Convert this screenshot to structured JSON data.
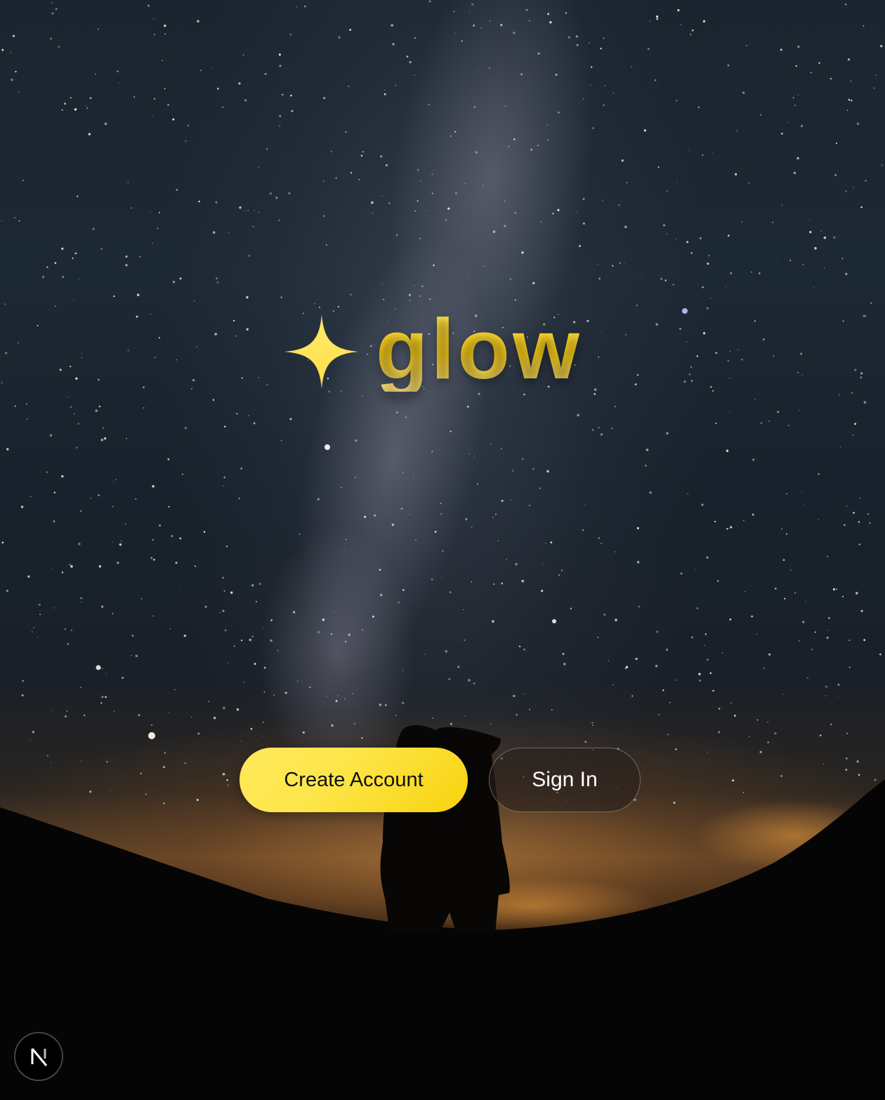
{
  "app": {
    "brand_name": "glow",
    "brand_icon": "sparkle-star-icon",
    "brand_color": "#ffd61e"
  },
  "actions": {
    "create_account_label": "Create Account",
    "sign_in_label": "Sign In"
  },
  "dev_badge": {
    "icon": "nextjs-logo-icon",
    "letter": "N"
  },
  "background": {
    "scene": "night-sky-milky-way",
    "horizon_glow": "#d68c3c"
  }
}
